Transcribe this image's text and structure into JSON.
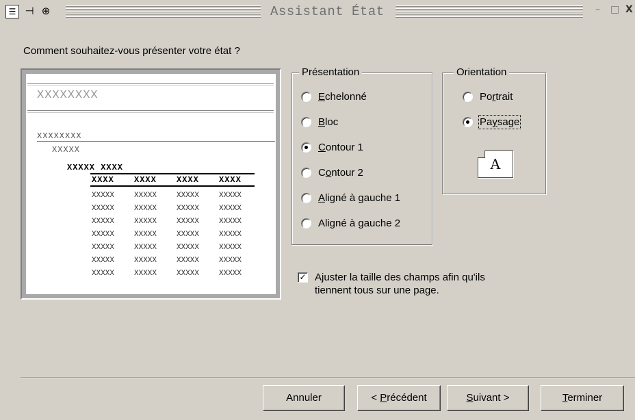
{
  "window": {
    "title": "Assistant État",
    "minimize_glyph": "–",
    "restore_glyph": "□",
    "close_glyph": "X"
  },
  "titlebar_icons": [
    "form-icon",
    "pin-icon",
    "scroll-icon"
  ],
  "question": "Comment souhaitez-vous présenter votre état ?",
  "preview": {
    "heading": "XXXXXXXX",
    "level1": "XXXXXXXX",
    "level2": "XXXXX",
    "level3": "XXXXX XXXX",
    "columns": [
      "XXXX",
      "XXXX",
      "XXXX",
      "XXXX"
    ],
    "cell": "XXXXX",
    "row_count": 7
  },
  "presentation": {
    "legend": "Présentation",
    "options": [
      {
        "prefix": "",
        "key": "E",
        "suffix": "chelonné",
        "selected": false
      },
      {
        "prefix": "",
        "key": "B",
        "suffix": "loc",
        "selected": false
      },
      {
        "prefix": "",
        "key": "C",
        "suffix": "ontour 1",
        "selected": true
      },
      {
        "prefix": "C",
        "key": "o",
        "suffix": "ntour 2",
        "selected": false
      },
      {
        "prefix": "",
        "key": "A",
        "suffix": "ligné à gauche 1",
        "selected": false
      },
      {
        "prefix": "Ali",
        "key": "g",
        "suffix": "né à gauche 2",
        "selected": false
      }
    ]
  },
  "orientation": {
    "legend": "Orientation",
    "options": [
      {
        "prefix": "Po",
        "key": "r",
        "suffix": "trait",
        "selected": false
      },
      {
        "prefix": "Pa",
        "key": "y",
        "suffix": "sage",
        "selected": true
      }
    ],
    "icon_letter": "A"
  },
  "fit_checkbox": {
    "checked": true,
    "prefix": "A",
    "key": "j",
    "line1_rest": "uster la taille des champs afin qu'ils",
    "line2": "tiennent tous sur une page."
  },
  "buttons": {
    "cancel": "Annuler",
    "previous": {
      "prefix": "< ",
      "key": "P",
      "suffix": "récédent"
    },
    "next": {
      "prefix": "",
      "key": "S",
      "suffix": "uivant >"
    },
    "finish": {
      "prefix": "",
      "key": "T",
      "suffix": "erminer"
    }
  },
  "colors": {
    "dialog_bg": "#d4d0c8",
    "preview_bg": "#a9a9a9",
    "paper": "#ffffff",
    "title_text": "#707070"
  }
}
